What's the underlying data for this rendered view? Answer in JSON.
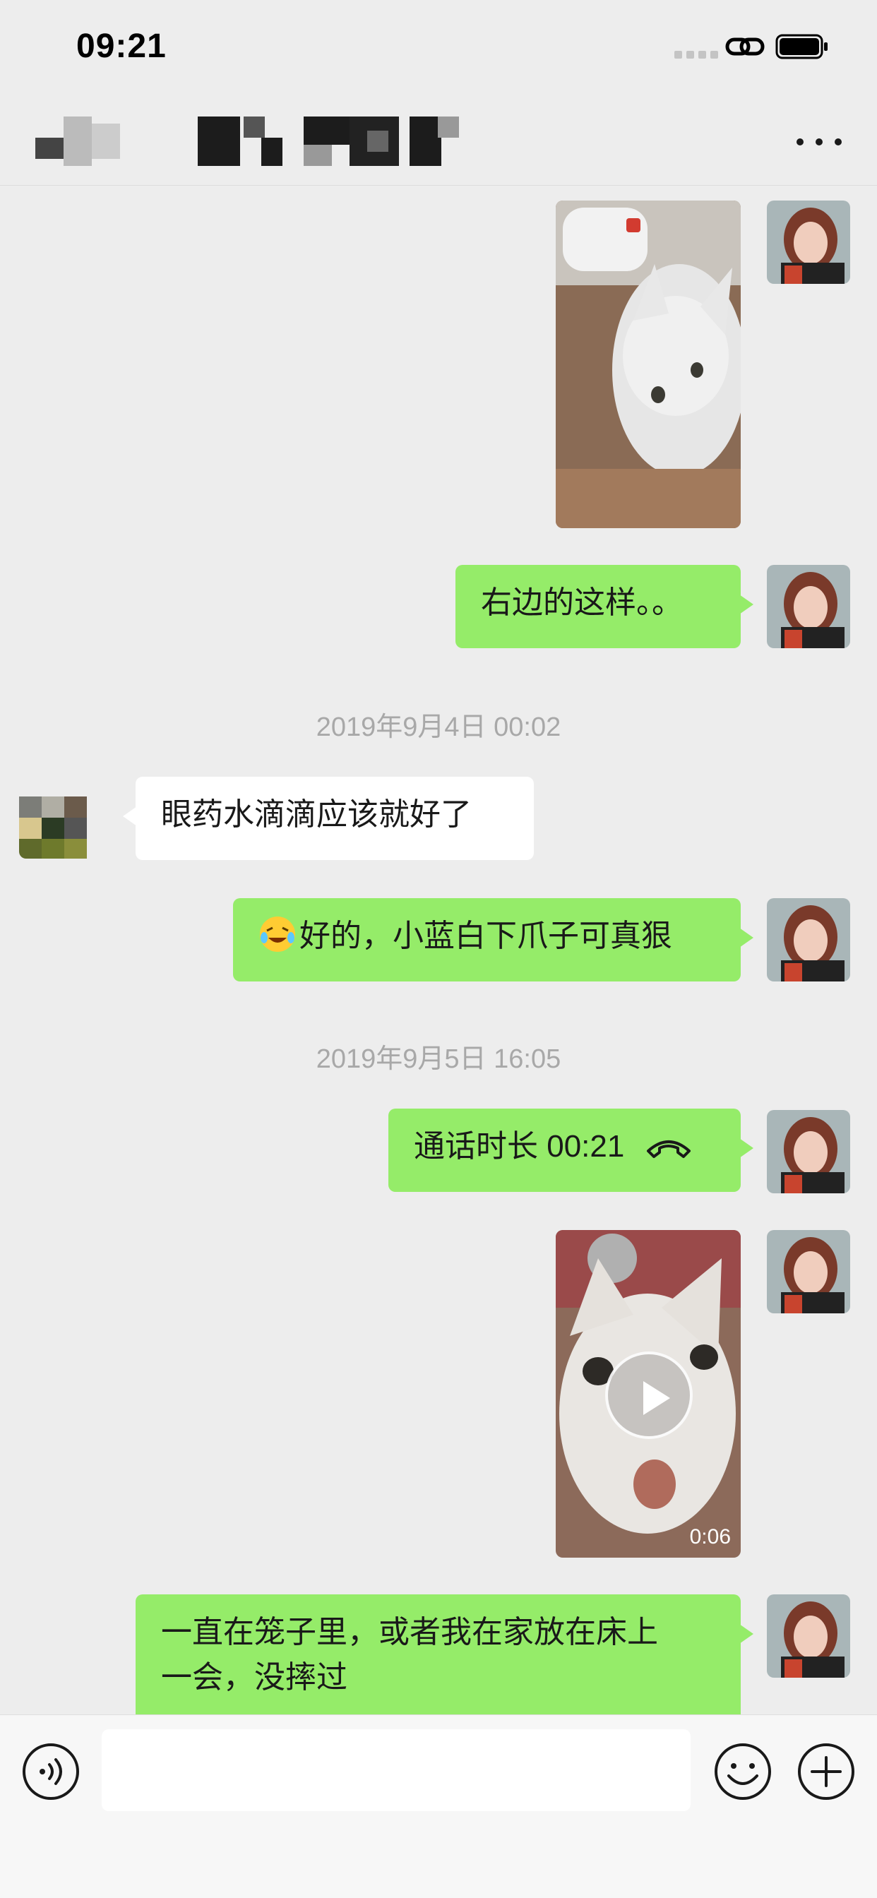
{
  "status_bar": {
    "time": "09:21"
  },
  "header": {
    "title_redacted": true,
    "more_icon": "more-icon"
  },
  "messages": [
    {
      "type": "image",
      "sender": "me",
      "content": "kitten photo"
    },
    {
      "type": "text",
      "sender": "me",
      "text": "右边的这样。。"
    },
    {
      "type": "timestamp",
      "text": "2019年9月4日 00:02"
    },
    {
      "type": "text",
      "sender": "other",
      "text": "眼药水滴滴应该就好了"
    },
    {
      "type": "text",
      "sender": "me",
      "emoji": "laughing-tears-emoji",
      "text": "好的，小蓝白下爪子可真狠"
    },
    {
      "type": "timestamp",
      "text": "2019年9月5日 16:05"
    },
    {
      "type": "call",
      "sender": "me",
      "text": "通话时长 00:21",
      "icon": "phone-hangup-icon"
    },
    {
      "type": "video",
      "sender": "me",
      "duration": "0:06"
    },
    {
      "type": "text",
      "sender": "me",
      "lines": [
        "一直在笼子里，或者我在家放在床上",
        "一会，没摔过"
      ]
    }
  ],
  "input_bar": {
    "placeholder": "",
    "voice_icon": "voice-icon",
    "emoji_icon": "emoji-icon",
    "plus_icon": "plus-icon"
  },
  "colors": {
    "me_bubble": "#95ec69",
    "other_bubble": "#ffffff",
    "background": "#ededed",
    "timestamp": "#a8a8a8"
  }
}
